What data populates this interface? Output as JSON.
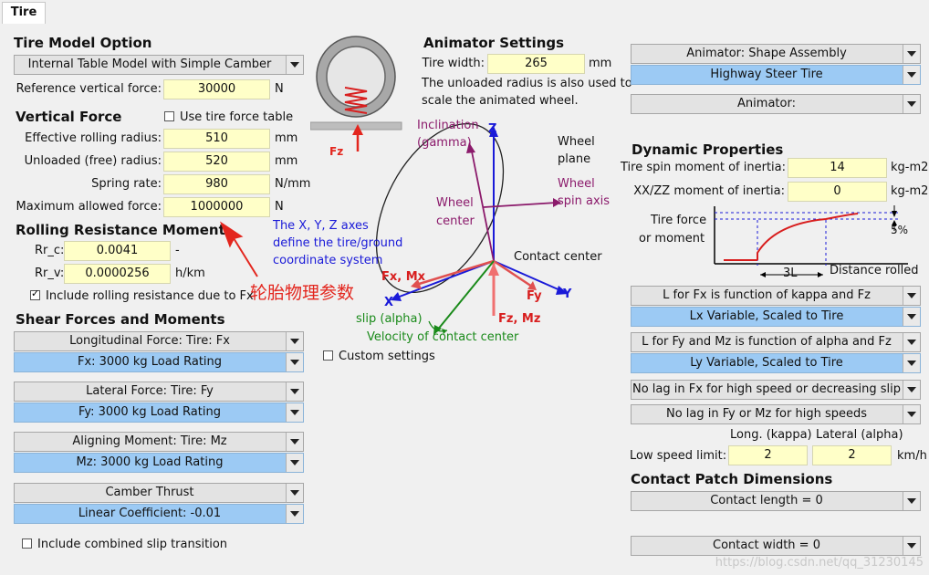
{
  "tab": "Tire",
  "tire_model": {
    "heading": "Tire Model Option",
    "selected": "Internal Table Model with Simple Camber",
    "ref_force_label": "Reference vertical force:",
    "ref_force_value": "30000",
    "ref_force_unit": "N"
  },
  "vertical_force": {
    "heading": "Vertical Force",
    "use_table_label": "Use tire force table",
    "use_table_checked": false,
    "rows": [
      {
        "label": "Effective rolling radius:",
        "value": "510",
        "unit": "mm"
      },
      {
        "label": "Unloaded (free) radius:",
        "value": "520",
        "unit": "mm"
      },
      {
        "label": "Spring rate:",
        "value": "980",
        "unit": "N/mm"
      },
      {
        "label": "Maximum allowed force:",
        "value": "1000000",
        "unit": "N"
      }
    ]
  },
  "rolling_resistance": {
    "heading": "Rolling Resistance Moment",
    "rows": [
      {
        "label": "Rr_c:",
        "value": "0.0041",
        "unit": "-"
      },
      {
        "label": "Rr_v:",
        "value": "0.0000256",
        "unit": "h/km"
      }
    ],
    "include_label": "Include rolling resistance due to Fx",
    "include_checked": true
  },
  "shear": {
    "heading": "Shear Forces and Moments",
    "groups": [
      {
        "top": "Longitudinal Force: Tire: Fx",
        "bottom": "Fx: 3000 kg Load Rating"
      },
      {
        "top": "Lateral Force: Tire: Fy",
        "bottom": "Fy: 3000 kg Load Rating"
      },
      {
        "top": "Aligning Moment: Tire: Mz",
        "bottom": "Mz: 3000 kg Load Rating"
      },
      {
        "top": "Camber Thrust",
        "bottom": "Linear Coefficient: -0.01"
      }
    ],
    "combined_label": "Include combined slip transition",
    "combined_checked": false
  },
  "annotation": {
    "chinese": "轮胎物理参数",
    "axes_note_1": "The X, Y, Z axes",
    "axes_note_2": "define the tire/ground",
    "axes_note_3": "coordinate system"
  },
  "animator": {
    "heading": "Animator Settings",
    "width_label": "Tire width:",
    "width_value": "265",
    "width_unit": "mm",
    "note_1": "The unloaded radius is also used to",
    "note_2": "scale the animated wheel.",
    "shape_assembly": "Animator: Shape Assembly",
    "shape_selected": "Highway Steer Tire",
    "animator2": "Animator:"
  },
  "diagram": {
    "fz_small": "Fz",
    "inclination_1": "Inclination",
    "inclination_2": "(gamma)",
    "z": "Z",
    "wheel_plane_1": "Wheel",
    "wheel_plane_2": "plane",
    "wheel_center_1": "Wheel",
    "wheel_center_2": "center",
    "spin_axis_1": "Wheel",
    "spin_axis_2": "spin axis",
    "contact_center": "Contact center",
    "fx_mx": "Fx, Mx",
    "fy": "Fy",
    "x": "X",
    "y": "Y",
    "fz_mz": "Fz, Mz",
    "slip": "slip (alpha)",
    "velocity": "Velocity of contact center",
    "custom_label": "Custom settings",
    "custom_checked": false
  },
  "dynamic": {
    "heading": "Dynamic Properties",
    "rows": [
      {
        "label": "Tire spin moment of inertia:",
        "value": "14",
        "unit": "kg-m2"
      },
      {
        "label": "XX/ZZ moment of inertia:",
        "value": "0",
        "unit": "kg-m2"
      }
    ],
    "graph_y_1": "Tire force",
    "graph_y_2": "or moment",
    "graph_pct": "5%",
    "graph_3l": "3L",
    "graph_x": "Distance rolled",
    "lfx_top": "L for Fx is function of kappa and Fz",
    "lfx_bottom": "Lx Variable, Scaled to Tire",
    "lfy_top": "L for Fy and Mz is function of alpha and Fz",
    "lfy_bottom": "Ly Variable, Scaled to Tire",
    "nolag1": "No lag in Fx for high speed or decreasing slip",
    "nolag2": "No lag in Fy or Mz for high speeds",
    "long_hdr": "Long. (kappa)",
    "lat_hdr": "Lateral (alpha)",
    "low_speed_label": "Low speed limit:",
    "low_long": "2",
    "low_lat": "2",
    "low_unit": "km/h"
  },
  "contact_patch": {
    "heading": "Contact Patch Dimensions",
    "length": "Contact length = 0",
    "width": "Contact width = 0"
  },
  "watermark": "https://blog.csdn.net/qq_31230145"
}
